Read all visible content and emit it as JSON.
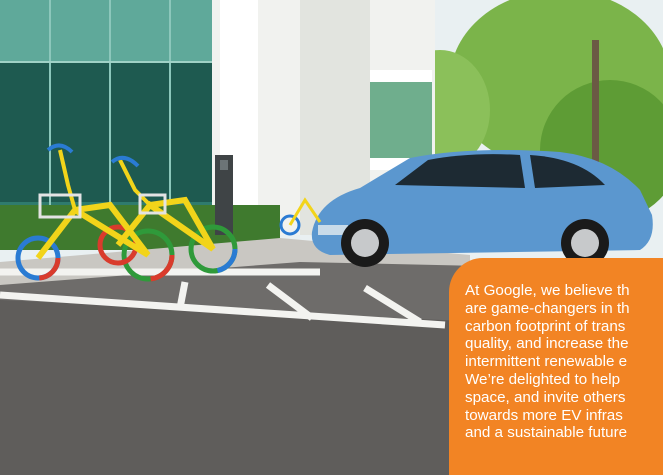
{
  "photo": {
    "subject": "google-campus-ev-parking",
    "colors": {
      "sky": "#e9f0f2",
      "building_glass": "#3d8f80",
      "car_body": "#5b97cf",
      "pavement": "#6e6c6a",
      "bike_frame": "#f2d41a"
    }
  },
  "callout": {
    "color": "#f28424",
    "lines": [
      "At Google, we believe th",
      "are game-changers in th",
      "carbon footprint of trans",
      "quality, and increase the",
      "intermittent renewable e",
      "We’re delighted to help",
      "space, and invite others",
      "towards more EV infras",
      "and a sustainable future"
    ]
  }
}
